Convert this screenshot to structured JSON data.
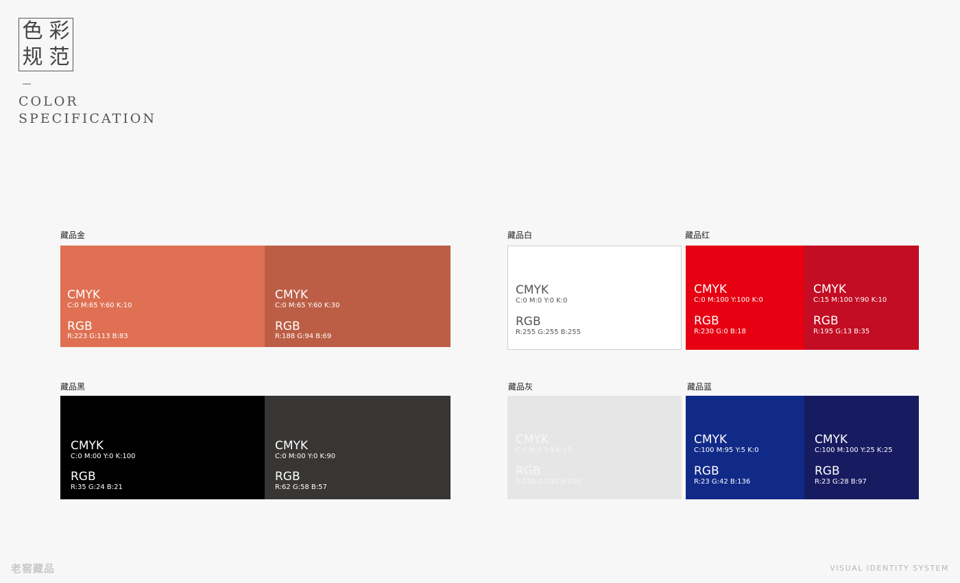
{
  "header": {
    "title_chars": [
      "色",
      "彩",
      "规",
      "范"
    ],
    "title_en_line1": "COLOR",
    "title_en_line2": "SPECIFICATION"
  },
  "groups": [
    {
      "label": "藏品金",
      "swatches": [
        {
          "color": "#df7053",
          "cmyk_title": "CMYK",
          "cmyk": "C:0  M:65  Y:60  K:10",
          "rgb_title": "RGB",
          "rgb": "R:223  G:113  B:83"
        },
        {
          "color": "#bc5e45",
          "cmyk_title": "CMYK",
          "cmyk": "C:0  M:65  Y:60  K:30",
          "rgb_title": "RGB",
          "rgb": "R:188  G:94  B:69"
        }
      ]
    },
    {
      "label": "藏品白",
      "swatches": [
        {
          "color": "#ffffff",
          "cmyk_title": "CMYK",
          "cmyk": "C:0  M:0  Y:0  K:0",
          "rgb_title": "RGB",
          "rgb": "R:255  G:255  B:255"
        }
      ]
    },
    {
      "label": "藏品红",
      "swatches": [
        {
          "color": "#e60012",
          "cmyk_title": "CMYK",
          "cmyk": "C:0  M:100  Y:100  K:0",
          "rgb_title": "RGB",
          "rgb": "R:230  G:0  B:18"
        },
        {
          "color": "#c30d23",
          "cmyk_title": "CMYK",
          "cmyk": "C:15  M:100  Y:90  K:10",
          "rgb_title": "RGB",
          "rgb": "R:195  G:13  B:35"
        }
      ]
    },
    {
      "label": "藏品黑",
      "swatches": [
        {
          "color": "#000000",
          "cmyk_title": "CMYK",
          "cmyk": "C:0  M:00  Y:0  K:100",
          "rgb_title": "RGB",
          "rgb": "R:35  G:24  B:21"
        },
        {
          "color": "#383634",
          "cmyk_title": "CMYK",
          "cmyk": "C:0  M:00  Y:0  K:90",
          "rgb_title": "RGB",
          "rgb": "R:62  G:58  B:57"
        }
      ]
    },
    {
      "label": "藏品灰",
      "swatches": [
        {
          "color": "#e6e6e6",
          "cmyk_title": "CMYK",
          "cmyk": "C:0  M:0  Y:0  K:15",
          "rgb_title": "RGB",
          "rgb": "R:230  G:230  B:230"
        }
      ]
    },
    {
      "label": "藏品蓝",
      "swatches": [
        {
          "color": "#112a88",
          "cmyk_title": "CMYK",
          "cmyk": "C:100  M:95  Y:5  K:0",
          "rgb_title": "RGB",
          "rgb": "R:23  G:42  B:136"
        },
        {
          "color": "#171c61",
          "cmyk_title": "CMYK",
          "cmyk": "C:100  M:100  Y:25  K:25",
          "rgb_title": "RGB",
          "rgb": "R:23  G:28  B:97"
        }
      ]
    }
  ],
  "footer": {
    "logo": "老窖藏品",
    "system": "VISUAL IDENTITY SYSTEM"
  }
}
